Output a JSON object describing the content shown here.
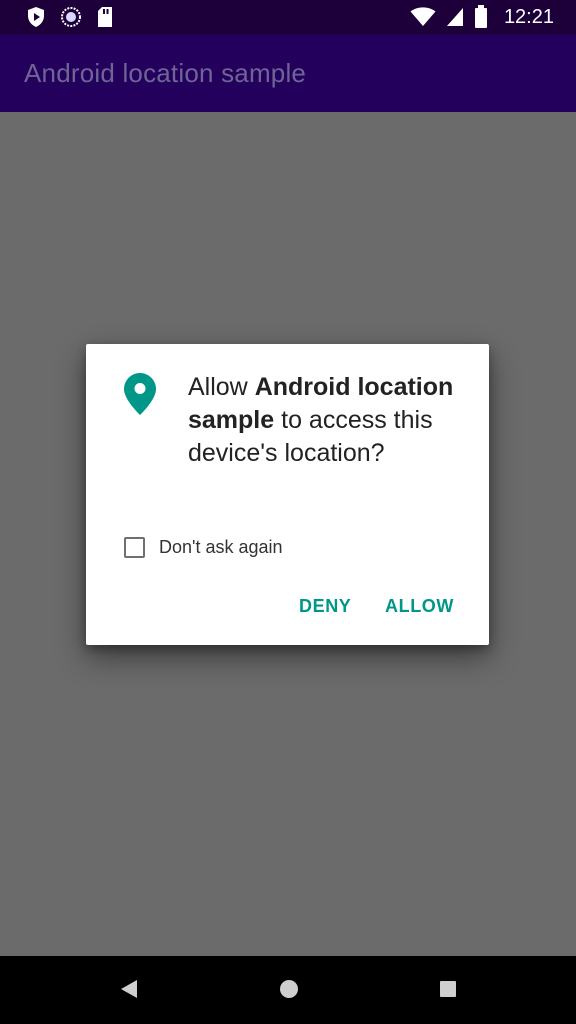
{
  "status_bar": {
    "time": "12:21",
    "icons": [
      "shield-play-icon",
      "sync-circle-icon",
      "sd-card-icon",
      "wifi-icon",
      "signal-icon",
      "battery-icon"
    ]
  },
  "app_bar": {
    "title": "Android location sample"
  },
  "dialog": {
    "message_prefix": "Allow ",
    "app_name": "Android location sample",
    "message_suffix": " to access this device's location?",
    "icon": "location-pin-icon",
    "checkbox_label": "Don't ask again",
    "checkbox_checked": false,
    "deny_label": "DENY",
    "allow_label": "ALLOW",
    "accent_color": "#009688"
  },
  "nav_bar": {
    "icons": [
      "back-icon",
      "home-icon",
      "recents-icon"
    ]
  }
}
